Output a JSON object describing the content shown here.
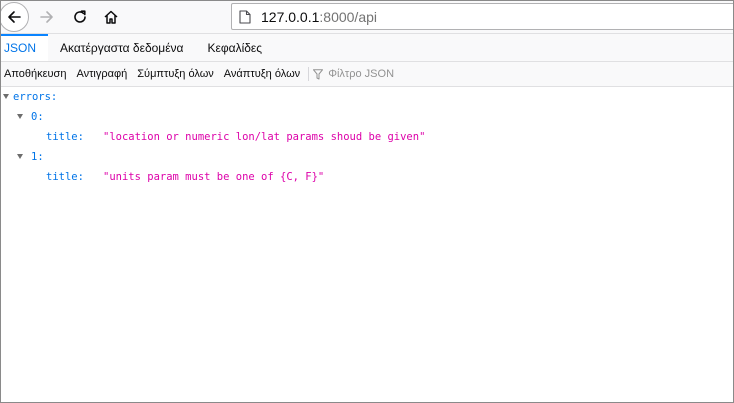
{
  "nav": {
    "back_icon": "back-arrow-icon",
    "forward_icon": "forward-arrow-icon",
    "reload_icon": "reload-icon",
    "home_icon": "home-icon",
    "page_icon": "page-icon",
    "url_host": "127.0.0.1",
    "url_rest": ":8000/api"
  },
  "tabs": [
    {
      "label": "JSON",
      "selected": true
    },
    {
      "label": "Ακατέργαστα δεδομένα",
      "selected": false
    },
    {
      "label": "Κεφαλίδες",
      "selected": false
    }
  ],
  "toolbar": {
    "save_label": "Αποθήκευση",
    "copy_label": "Αντιγραφή",
    "collapse_label": "Σύμπτυξη όλων",
    "expand_label": "Ανάπτυξη όλων",
    "filter_placeholder": "Φίλτρο JSON",
    "filter_icon": "funnel-icon"
  },
  "tree": {
    "root_key": "errors:",
    "items": [
      {
        "index_key": "0:",
        "field_key": "title:",
        "field_value": "\"location or numeric lon/lat params shoud be given\""
      },
      {
        "index_key": "1:",
        "field_key": "title:",
        "field_value": "\"units param must be one of {C, F}\""
      }
    ]
  },
  "colors": {
    "accent": "#0a84ff",
    "key": "#0074e8",
    "string": "#dd00a9"
  }
}
